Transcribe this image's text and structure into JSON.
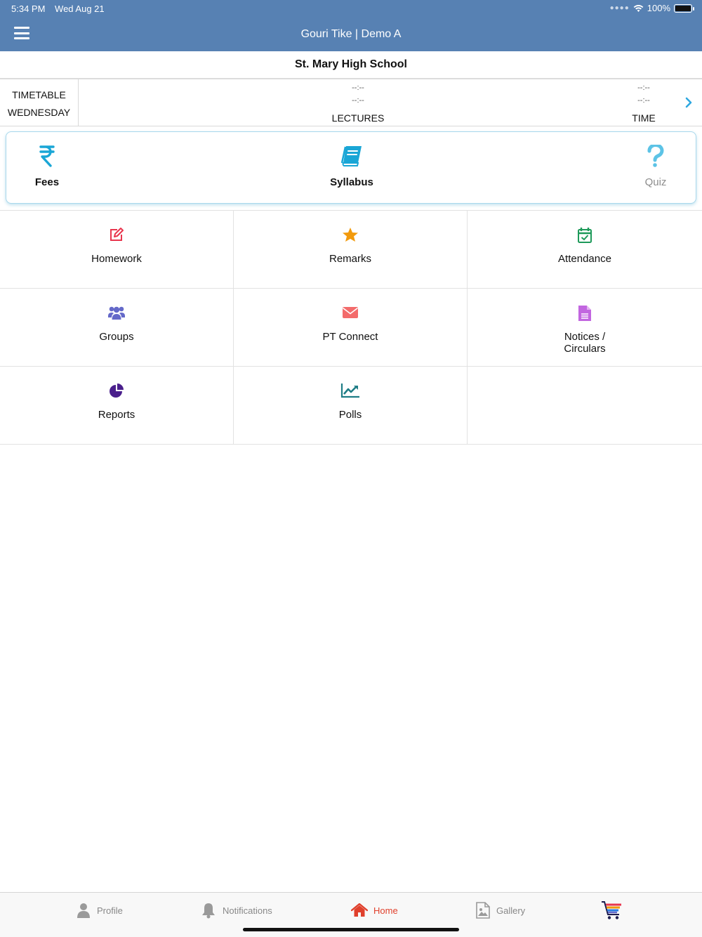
{
  "status_bar": {
    "time": "5:34 PM",
    "date": "Wed Aug 21",
    "battery": "100%"
  },
  "header": {
    "title": "Gouri Tike | Demo A"
  },
  "school": {
    "name": "St. Mary High School"
  },
  "timetable": {
    "label_line1": "TIMETABLE",
    "label_line2": "WEDNESDAY",
    "lectures": {
      "value1": "--:--",
      "value2": "--:--",
      "heading": "LECTURES"
    },
    "time": {
      "value1": "--:--",
      "value2": "--:--",
      "heading": "TIME"
    }
  },
  "quick_links": [
    {
      "label": "Fees",
      "icon": "rupee-icon",
      "color": "#1aa6d6"
    },
    {
      "label": "Syllabus",
      "icon": "book-icon",
      "color": "#1aa6d6"
    },
    {
      "label": "Quiz",
      "icon": "question-icon",
      "color": "#1aa6d6"
    }
  ],
  "grid": [
    {
      "label": "Homework",
      "icon": "edit-icon",
      "color": "#e8364e"
    },
    {
      "label": "Remarks",
      "icon": "star-icon",
      "color": "#f29a0c"
    },
    {
      "label": "Attendance",
      "icon": "calendar-check-icon",
      "color": "#1e9a5a"
    },
    {
      "label": "Groups",
      "icon": "users-icon",
      "color": "#6469c9"
    },
    {
      "label": "PT Connect",
      "icon": "envelope-icon",
      "color": "#f36b6b"
    },
    {
      "label": "Notices / Circulars",
      "icon": "document-icon",
      "color": "#c266e0"
    },
    {
      "label": "Reports",
      "icon": "pie-chart-icon",
      "color": "#4a1f8c"
    },
    {
      "label": "Polls",
      "icon": "line-chart-icon",
      "color": "#1f7d86"
    }
  ],
  "bottom_nav": [
    {
      "label": "Profile",
      "icon": "user-icon"
    },
    {
      "label": "Notifications",
      "icon": "bell-icon"
    },
    {
      "label": "Home",
      "icon": "home-icon",
      "active": true,
      "color": "#e0402c"
    },
    {
      "label": "Gallery",
      "icon": "image-icon"
    },
    {
      "label": "",
      "icon": "cart-icon"
    }
  ],
  "colors": {
    "header": "#5781b3",
    "accent": "#1aa6d6",
    "active_nav": "#e0402c"
  }
}
